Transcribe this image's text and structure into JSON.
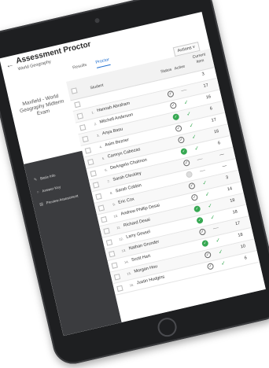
{
  "header": {
    "back_icon": "←",
    "title": "Assessment Proctor",
    "subject": "World Geography",
    "tabs": [
      {
        "label": "Results"
      },
      {
        "label": "Proctor"
      }
    ],
    "actions_label": "Actions ˅"
  },
  "left_panel": {
    "exam_title": "Maxfield - World Geography Midterm Exam",
    "nav": [
      {
        "icon": "✎",
        "label": "Basic Info"
      },
      {
        "icon": "○",
        "label": "Answer Key"
      },
      {
        "icon": "▤",
        "label": "Preview Assessment"
      }
    ]
  },
  "table": {
    "headers": {
      "student": "Student",
      "status": "Status",
      "active": "Active",
      "current_item": "Current Item"
    },
    "rows": [
      {
        "num": "",
        "name": "",
        "status": "",
        "active": "",
        "item": "3"
      },
      {
        "num": "1.",
        "name": "Hannah Abraham",
        "status": "check",
        "active": "—",
        "item": "17"
      },
      {
        "num": "2.",
        "name": "Mitchell Anderson",
        "status": "check",
        "active": "✓",
        "item": "16"
      },
      {
        "num": "3.",
        "name": "Anya Basu",
        "status": "active",
        "active": "✓",
        "item": "6"
      },
      {
        "num": "4.",
        "name": "Asim Bezner",
        "status": "check",
        "active": "✓",
        "item": "17"
      },
      {
        "num": "5.",
        "name": "Camryn Cabezas",
        "status": "check",
        "active": "✓",
        "item": "16"
      },
      {
        "num": "6.",
        "name": "DeAngelo Chalmon",
        "status": "active",
        "active": "✓",
        "item": "6"
      },
      {
        "num": "7.",
        "name": "Sarah Cleckley",
        "status": "check",
        "active": "—",
        "item": "—"
      },
      {
        "num": "8.",
        "name": "Sarah Cobbin",
        "status": "idle",
        "active": "—",
        "item": "—"
      },
      {
        "num": "9.",
        "name": "Eric Cox",
        "status": "check",
        "active": "✓",
        "item": "3"
      },
      {
        "num": "10.",
        "name": "Andrew Phillip Desai",
        "status": "check",
        "active": "✓",
        "item": "14"
      },
      {
        "num": "11.",
        "name": "Richard Desai",
        "status": "active",
        "active": "✓",
        "item": "18"
      },
      {
        "num": "12.",
        "name": "Larry Gessel",
        "status": "active",
        "active": "✓",
        "item": "18"
      },
      {
        "num": "13.",
        "name": "Nathan Grunder",
        "status": "check",
        "active": "—",
        "item": "17"
      },
      {
        "num": "14.",
        "name": "Scott Hart",
        "status": "active",
        "active": "✓",
        "item": "18"
      },
      {
        "num": "15.",
        "name": "Morgan Hou",
        "status": "check",
        "active": "✓",
        "item": "10"
      },
      {
        "num": "16.",
        "name": "Justin Hudgins",
        "status": "check",
        "active": "✓",
        "item": "6"
      }
    ]
  },
  "colors": {
    "accent": "#1f6fd0",
    "active_green": "#36a852",
    "nav_dark": "#3b3c3f",
    "bezel": "#1e1f21"
  }
}
